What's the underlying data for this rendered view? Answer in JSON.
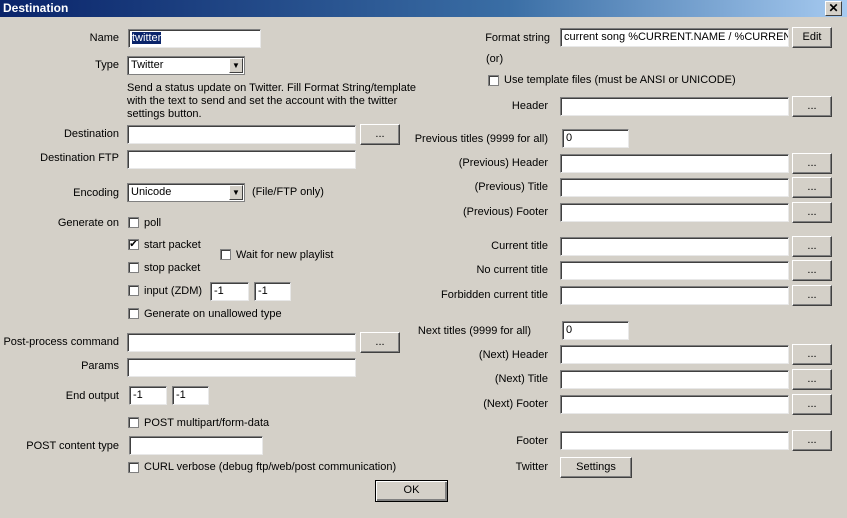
{
  "window": {
    "title": "Destination",
    "close": "✕"
  },
  "left": {
    "name_label": "Name",
    "name_value": "twitter",
    "type_label": "Type",
    "type_value": "Twitter",
    "description": "Send a status update on Twitter. Fill Format String/template with the text to send and set the account with the twitter settings button.",
    "destination_label": "Destination",
    "destination_value": "",
    "destination_ftp_label": "Destination FTP",
    "destination_ftp_value": "",
    "encoding_label": "Encoding",
    "encoding_value": "Unicode",
    "encoding_note": "(File/FTP only)",
    "generate_on_label": "Generate on",
    "poll_label": "poll",
    "poll_checked": false,
    "start_packet_label": "start packet",
    "start_packet_checked": true,
    "stop_packet_label": "stop packet",
    "stop_packet_checked": false,
    "wait_playlist_label": "Wait for new playlist",
    "wait_playlist_checked": false,
    "input_zdm_label": "input (ZDM)",
    "input_zdm_checked": false,
    "input_zdm_a": "-1",
    "input_zdm_b": "-1",
    "unallowed_label": "Generate on unallowed type",
    "unallowed_checked": false,
    "postprocess_label": "Post-process command",
    "postprocess_value": "",
    "params_label": "Params",
    "params_value": "",
    "end_output_label": "End output",
    "end_output_a": "-1",
    "end_output_b": "-1",
    "post_multipart_label": "POST multipart/form-data",
    "post_multipart_checked": false,
    "post_content_label": "POST content type",
    "post_content_value": "",
    "curl_label": "CURL verbose (debug ftp/web/post communication)",
    "curl_checked": false
  },
  "right": {
    "format_label": "Format string",
    "format_or": "(or)",
    "format_value": "current song %CURRENT.NAME / %CURRENT",
    "edit_label": "Edit",
    "use_template_label": "Use template files (must be ANSI or UNICODE)",
    "use_template_checked": false,
    "header_label": "Header",
    "prev_titles_label": "Previous titles (9999 for all)",
    "prev_titles_value": "0",
    "prev_header_label": "(Previous) Header",
    "prev_title_label": "(Previous) Title",
    "prev_footer_label": "(Previous) Footer",
    "current_title_label": "Current title",
    "no_current_title_label": "No current title",
    "forbidden_label": "Forbidden current title",
    "next_titles_label": "Next titles (9999 for all)",
    "next_titles_value": "0",
    "next_header_label": "(Next) Header",
    "next_title_label": "(Next) Title",
    "next_footer_label": "(Next) Footer",
    "footer_label": "Footer",
    "twitter_label": "Twitter",
    "settings_label": "Settings"
  },
  "browse_label": "...",
  "ok_label": "OK",
  "icons": {
    "checkmark": "✔",
    "dropdown": "▼"
  }
}
